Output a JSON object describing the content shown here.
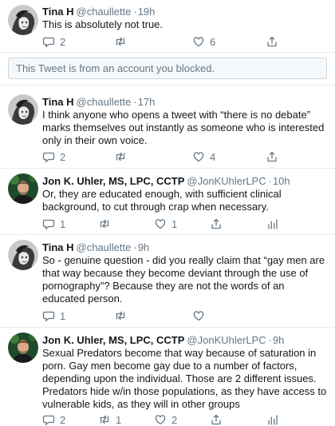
{
  "tweets": [
    {
      "name": "Tina H",
      "handle": "@chaullette",
      "time": "19h",
      "text": "This is absolutely not true.",
      "reply_count": "2",
      "retweet_count": "",
      "like_count": "6"
    },
    {
      "name": "Tina H",
      "handle": "@chaullette",
      "time": "17h",
      "text": "I think anyone who opens a tweet with “there is no debate” marks themselves out instantly as someone who is interested only in their own voice.",
      "reply_count": "2",
      "retweet_count": "",
      "like_count": "4"
    },
    {
      "name": "Jon K. Uhler, MS, LPC, CCTP",
      "handle": "@JonKUhlerLPC",
      "time": "10h",
      "text": "Or, they are educated enough, with sufficient clinical background, to cut through crap when necessary.",
      "reply_count": "1",
      "retweet_count": "",
      "like_count": "1"
    },
    {
      "name": "Tina H",
      "handle": "@chaullette",
      "time": "9h",
      "text": "So - genuine question - did you really claim that “gay men are that way because they become deviant through the use of pornography”? Because they are not the words of an educated person.",
      "reply_count": "1",
      "retweet_count": "",
      "like_count": ""
    },
    {
      "name": "Jon K. Uhler, MS, LPC, CCTP",
      "handle": "@JonKUhlerLPC",
      "time": "9h",
      "text": "Sexual Predators become that way because of saturation in porn. Gay men become gay due to a number of factors, depending upon the individual. Those are 2 different issues. Predators hide w/in those populations, as they have access to vulnerable kids, as they will in other groups",
      "reply_count": "2",
      "retweet_count": "1",
      "like_count": "2"
    }
  ],
  "blocked_notice": "This Tweet is from an account you blocked.",
  "colors": {
    "muted": "#657786",
    "accent": "#1da1f2",
    "divider": "#e6ecf0"
  },
  "icons": [
    "reply-icon",
    "retweet-icon",
    "like-icon",
    "share-icon",
    "analytics-icon"
  ]
}
